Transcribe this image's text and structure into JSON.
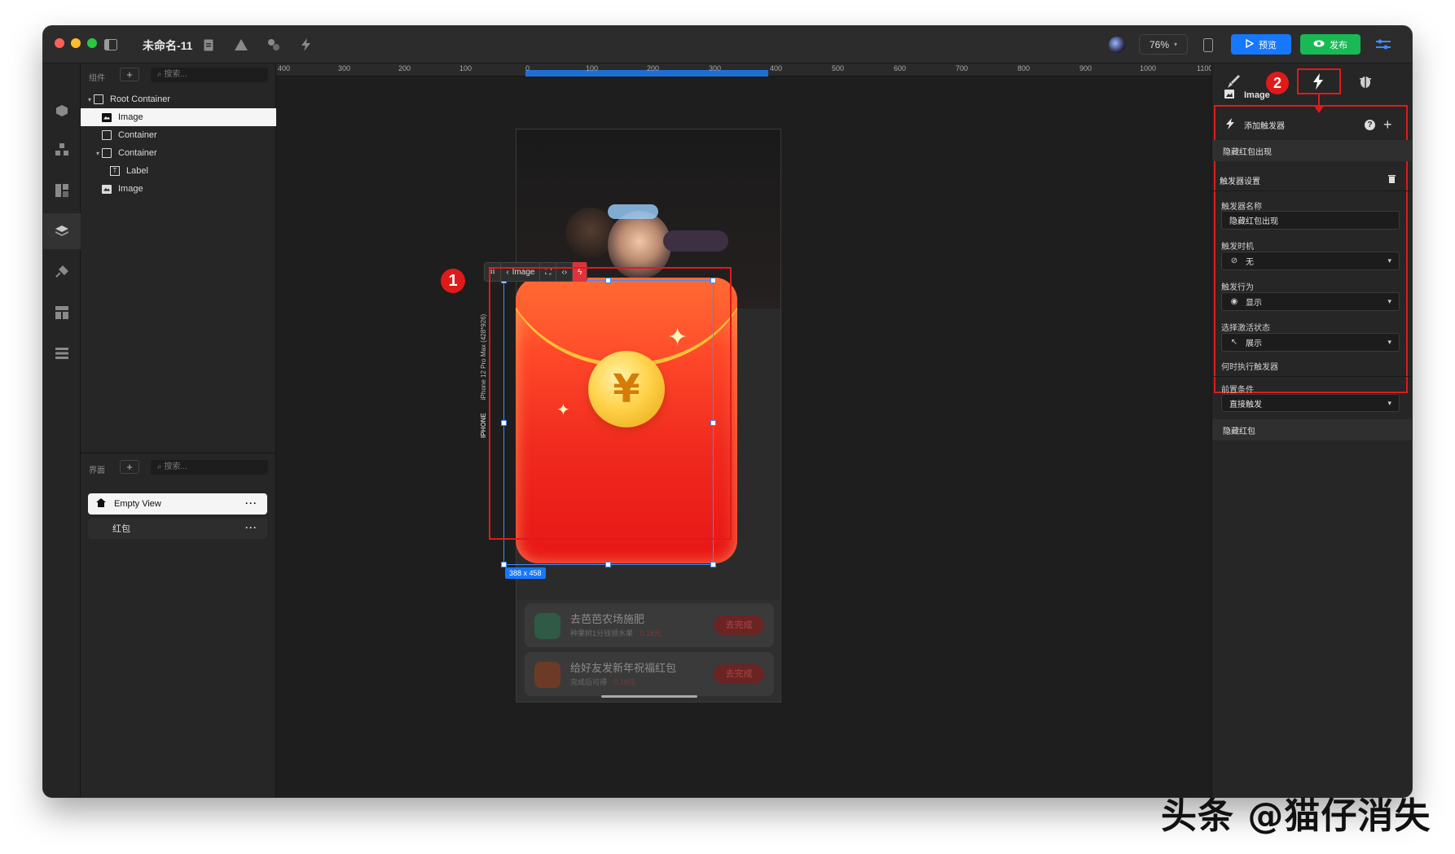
{
  "window": {
    "title": "未命名-11"
  },
  "toolbar": {
    "zoom": "76%",
    "preview_label": "预览",
    "publish_label": "发布"
  },
  "layers_panel": {
    "header_label": "组件",
    "search_placeholder": "搜索...",
    "tree": [
      {
        "label": "Root Container",
        "type": "container"
      },
      {
        "label": "Image",
        "type": "image"
      },
      {
        "label": "Container",
        "type": "container"
      },
      {
        "label": "Container",
        "type": "container"
      },
      {
        "label": "Label",
        "type": "label"
      },
      {
        "label": "Image",
        "type": "image"
      }
    ]
  },
  "pages_panel": {
    "header_label": "界面",
    "search_placeholder": "搜索...",
    "pages": [
      {
        "label": "Empty View"
      },
      {
        "label": "红包"
      }
    ]
  },
  "canvas": {
    "ruler_labels": [
      "400",
      "300",
      "200",
      "100",
      "0",
      "100",
      "200",
      "300",
      "400",
      "500",
      "600",
      "700",
      "800",
      "900",
      "1000",
      "1100"
    ],
    "device_label_brand": "IPHONE",
    "device_label_model": "iPhone 12 Pro Max (428*926)",
    "selected_label": "Image",
    "size_tag": "388 x 458",
    "badge_1": "1",
    "coin_symbol": "¥",
    "tasks": [
      {
        "title": "去芭芭农场施肥",
        "sub": "种果树1分钱领水果",
        "reward": "0.18元",
        "button": "去完成"
      },
      {
        "title": "给好友发新年祝福红包",
        "sub": "完成后可得",
        "reward": "0.18元",
        "button": "去完成"
      }
    ]
  },
  "right_panel": {
    "badge_2": "2",
    "component_name": "Image",
    "add_trigger_label": "添加触发器",
    "trigger_item": "隐藏红包出现",
    "trigger_settings_label": "触发器设置",
    "trigger_name_label": "触发器名称",
    "trigger_name_value": "隐藏红包出现",
    "trigger_time_label": "触发时机",
    "trigger_time_value": "无",
    "trigger_action_label": "触发行为",
    "trigger_action_value": "显示",
    "activate_state_label": "选择激活状态",
    "activate_state_value": "展示",
    "when_execute_label": "何时执行触发器",
    "precondition_label": "前置条件",
    "precondition_value": "直接触发",
    "second_trigger": "隐藏红包"
  },
  "watermark": "头条 @猫仔消失",
  "colors": {
    "accent_red": "#e01a1a",
    "preview_blue": "#1677ff",
    "publish_green": "#19b955"
  }
}
